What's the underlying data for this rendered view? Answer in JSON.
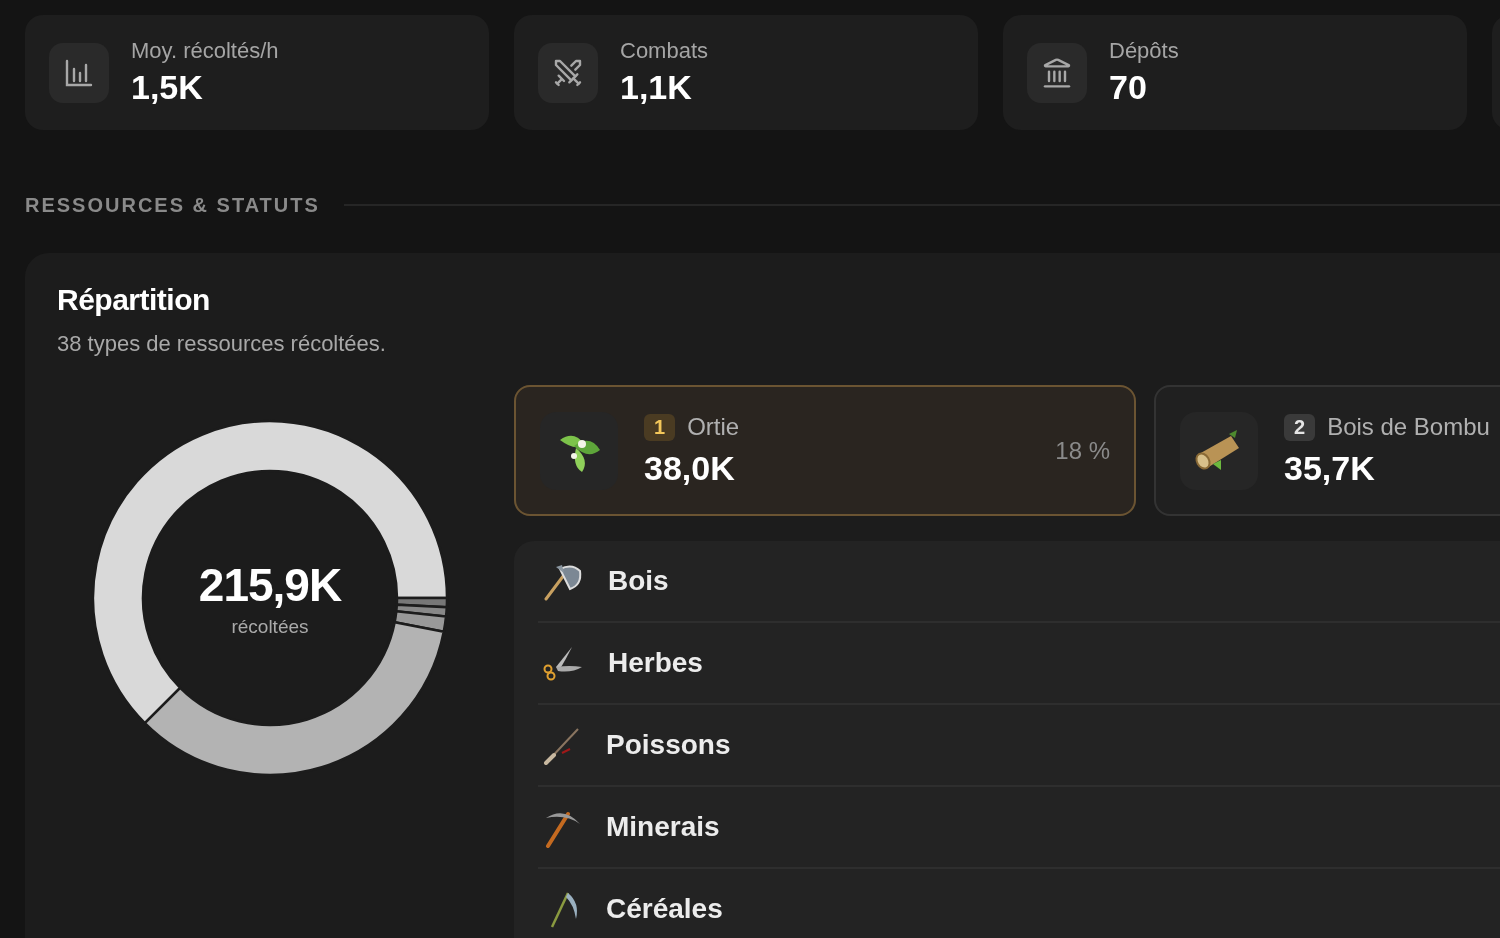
{
  "stats": [
    {
      "kind": "chart",
      "label": "Moy. récoltés/h",
      "value": "1,5K"
    },
    {
      "kind": "swords",
      "label": "Combats",
      "value": "1,1K"
    },
    {
      "kind": "bank",
      "label": "Dépôts",
      "value": "70"
    }
  ],
  "section_title": "RESSOURCES & STATUTS",
  "panel": {
    "title": "Répartition",
    "subtitle": "38 types de ressources récoltées.",
    "donut": {
      "total": "215,9K",
      "caption": "récoltées"
    },
    "top_resources": [
      {
        "kind": "leaf",
        "rank": "1",
        "name": "Ortie",
        "value": "38,0K",
        "share": "18 %",
        "selected": true
      },
      {
        "kind": "log",
        "rank": "2",
        "name": "Bois de Bombu",
        "value": "35,7K",
        "selected": false
      }
    ],
    "categories": [
      {
        "kind": "axe",
        "name": "Bois"
      },
      {
        "kind": "scissors",
        "name": "Herbes"
      },
      {
        "kind": "rod",
        "name": "Poissons"
      },
      {
        "kind": "pickaxe",
        "name": "Minerais"
      },
      {
        "kind": "scythe",
        "name": "Céréales"
      }
    ]
  }
}
